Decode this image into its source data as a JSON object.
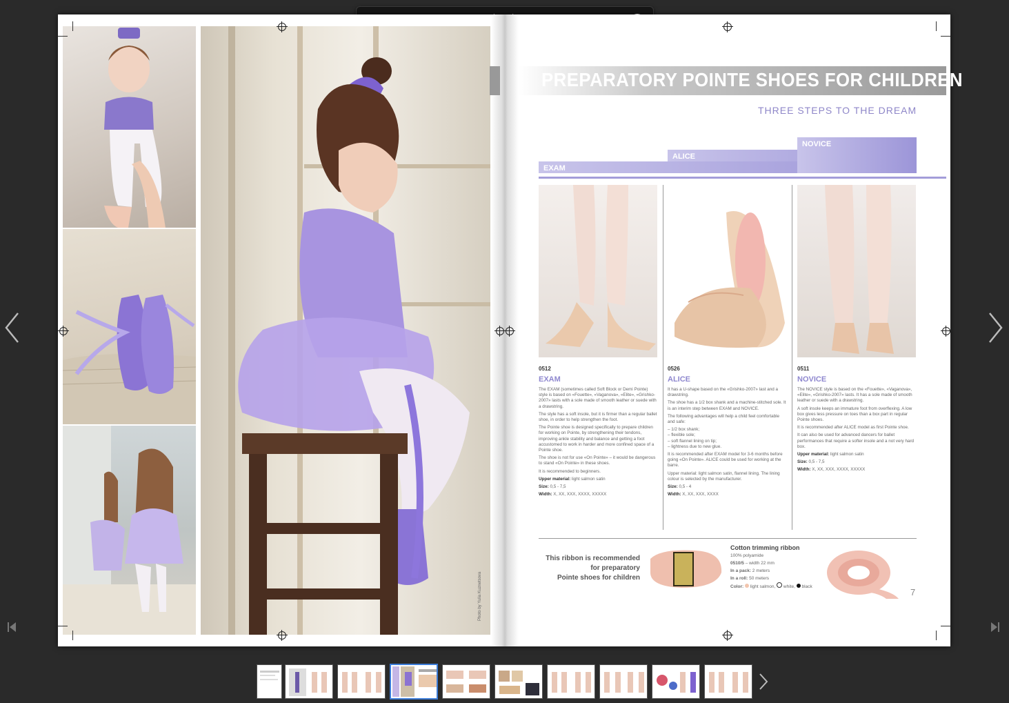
{
  "toolbar": {
    "icons": [
      "zoom-out-icon",
      "zoom-slider",
      "single-page-icon",
      "prev-page-icon",
      "next-page-icon",
      "search-icon",
      "pages-icon",
      "share-icon",
      "close-icon"
    ]
  },
  "page_right": {
    "title": "PREPARATORY POINTE SHOES FOR CHILDREN",
    "subtitle": "THREE STEPS TO THE DREAM",
    "steps": [
      "EXAM",
      "ALICE",
      "NOVICE"
    ],
    "products": [
      {
        "code": "0512",
        "name": "EXAM",
        "desc": [
          "The EXAM (sometimes called Soft Block or Demi Pointe) style is based on «Fouette», «Vaganova», «Elite», «Grishko-2007» lasts with a sole made of smooth leather or suede with a drawstring.",
          "The style has a soft insole, but it is firmer than a regular ballet shoe, in order to help strengthen the foot.",
          "The Pointe shoe is designed specifically to prepare children for working on Pointe, by strengthening their tendons, improving ankle stability and balance and getting a foot accustomed to work in harder and more confined space of a Pointe shoe.",
          "The shoe is not for use «On Pointe» – it would be dangerous to stand «On Pointe» in these shoes.",
          "It is recommended to beginners."
        ],
        "upper_label": "Upper material:",
        "upper_value": "light salmon satin",
        "size_label": "Size:",
        "size_value": "0,5 - 7,5",
        "width_label": "Width:",
        "width_value": "X, XX, XXX, XXXX, XXXXX"
      },
      {
        "code": "0526",
        "name": "ALICE",
        "desc": [
          "It has a U-shape based on the «Grishko-2007» last and a drawstring.",
          "The shoe has a 1/2 box shank and a machine-stitched sole. It is an interim step between EXAM and NOVICE.",
          "The following advantages will help a child feel comfortable and safe:",
          "– 1/2 box shank;",
          "– flexible sole;",
          "– soft flannel lining on tip;",
          "– lightness due to new glue.",
          "It is recommended after EXAM model for 3-6 months before going «On Pointe». ALICE could be used for working at the barre.",
          "Upper material: light salmon satin, flannel lining. The lining colour is selected by the manufacturer."
        ],
        "upper_label": "",
        "upper_value": "",
        "size_label": "Size:",
        "size_value": "0,5 - 4",
        "width_label": "Width:",
        "width_value": "X, XX, XXX, XXXX"
      },
      {
        "code": "0511",
        "name": "NOVICE",
        "desc": [
          "The NOVICE style is based on the «Fouette», «Vaganova», «Elite», «Grishko-2007» lasts. It has a sole made of smooth leather or suede with a drawstring.",
          "A soft insole keeps an immature foot from overflexing. A low box gives less pressure on toes than a box part in regular Pointe shoes.",
          "It is recommended after ALICE model as first Pointe shoe.",
          "It can also be used for advanced dancers for ballet performances that require a softer insole and a not very hard box."
        ],
        "upper_label": "Upper material:",
        "upper_value": "light salmon satin",
        "size_label": "Size:",
        "size_value": "0,5 - 7,5",
        "width_label": "Width:",
        "width_value": "X, XX, XXX, XXXX, XXXXX"
      }
    ],
    "ribbon": {
      "note_lines": [
        "This ribbon is recommended",
        "for preparatory",
        "Pointe shoes for children"
      ],
      "heading": "Cotton trimming ribbon",
      "material": "100% polyamide",
      "code": "0510/5",
      "width_text": "– width 22 mm",
      "pack_label": "In a pack:",
      "pack_value": "2 meters",
      "roll_label": "In a roll:",
      "roll_value": "50 meters",
      "color_label": "Color:",
      "colors": [
        "light salmon",
        "white",
        "black"
      ]
    },
    "page_number": "7"
  },
  "page_left": {
    "credit": "Photo by Yulia Kuznetsova"
  },
  "thumbnails": {
    "count": 10,
    "selected_index": 3
  },
  "colors": {
    "accent": "#8f88cf",
    "lilac": "#a39dd9",
    "background": "#2a2a2a"
  }
}
